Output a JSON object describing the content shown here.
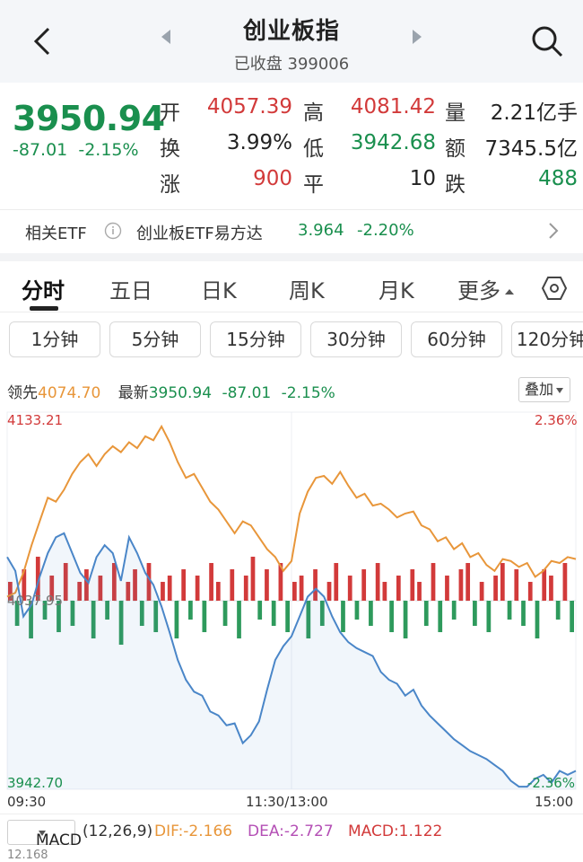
{
  "header": {
    "title": "创业板指",
    "subtitle": "已收盘 399006"
  },
  "quote": {
    "price": "3950.94",
    "change": "-87.01",
    "change_pct": "-2.15%",
    "open_label": "开",
    "open": "4057.39",
    "high_label": "高",
    "high": "4081.42",
    "volume_label": "量",
    "volume": "2.21亿手",
    "turnover_label": "换",
    "turnover": "3.99%",
    "low_label": "低",
    "low": "3942.68",
    "amount_label": "额",
    "amount": "7345.5亿",
    "up_label": "涨",
    "up": "900",
    "flat_label": "平",
    "flat": "10",
    "down_label": "跌",
    "down": "488"
  },
  "etf": {
    "label": "相关ETF",
    "name": "创业板ETF易方达",
    "price": "3.964",
    "change_pct": "-2.20%"
  },
  "tabs": [
    "分时",
    "五日",
    "日K",
    "周K",
    "月K",
    "更多"
  ],
  "periods": [
    "1分钟",
    "5分钟",
    "15分钟",
    "30分钟",
    "60分钟",
    "120分钟"
  ],
  "info_bar": {
    "leader_label": "领先",
    "leader": "4074.70",
    "latest_label": "最新",
    "latest": "3950.94",
    "change": "-87.01",
    "change_pct": "-2.15%",
    "overlay_label": "叠加"
  },
  "chart_data": {
    "type": "line",
    "y_max_label": "4133.21",
    "y_mid_label": "4037.95",
    "y_min_label": "3942.70",
    "pct_max_label": "2.36%",
    "pct_min_label": "-2.36%",
    "x_labels": [
      "09:30",
      "11:30/13:00",
      "15:00"
    ],
    "ylim": [
      3942.7,
      4133.21
    ],
    "prev_close": 4037.95,
    "series": [
      {
        "color": "#e8963a",
        "values": [
          4040,
          4042,
          4052,
          4066,
          4078,
          4090,
          4088,
          4094,
          4102,
          4108,
          4112,
          4106,
          4112,
          4116,
          4113,
          4118,
          4115,
          4121,
          4119,
          4126,
          4118,
          4108,
          4100,
          4102,
          4095,
          4088,
          4084,
          4078,
          4072,
          4078,
          4076,
          4070,
          4064,
          4060,
          4053,
          4058,
          4082,
          4093,
          4100,
          4101,
          4097,
          4103,
          4096,
          4090,
          4092,
          4086,
          4087,
          4084,
          4080,
          4082,
          4083,
          4076,
          4074,
          4068,
          4070,
          4064,
          4067,
          4060,
          4062,
          4056,
          4053,
          4059,
          4058,
          4055,
          4057,
          4050,
          4053,
          4058,
          4057,
          4060,
          4059
        ]
      },
      {
        "color": "#4a86c8",
        "values": [
          4060,
          4053,
          4030,
          4036,
          4050,
          4062,
          4070,
          4072,
          4062,
          4052,
          4047,
          4060,
          4066,
          4062,
          4048,
          4070,
          4062,
          4052,
          4046,
          4035,
          4022,
          4008,
          3998,
          3992,
          3990,
          3982,
          3980,
          3975,
          3976,
          3966,
          3970,
          3977,
          3993,
          4008,
          4015,
          4020,
          4030,
          4040,
          4044,
          4040,
          4030,
          4022,
          4017,
          4014,
          4012,
          4010,
          4002,
          3998,
          3996,
          3990,
          3993,
          3985,
          3980,
          3976,
          3972,
          3968,
          3965,
          3962,
          3960,
          3958,
          3955,
          3952,
          3947,
          3944,
          3944,
          3948,
          3950,
          3946,
          3952,
          3950,
          3952
        ]
      }
    ],
    "volume_bars": [
      3,
      -4,
      5,
      -6,
      7,
      -3,
      4,
      -5,
      6,
      -4,
      3,
      5,
      -6,
      4,
      -3,
      6,
      -7,
      3,
      5,
      -4,
      6,
      -5,
      3,
      4,
      -6,
      5,
      -3,
      4,
      -5,
      6,
      3,
      -4,
      5,
      -6,
      4,
      7,
      -3,
      5,
      -4,
      6,
      -5,
      3,
      4,
      -6,
      5,
      -4,
      3,
      6,
      -5,
      4,
      -3,
      5,
      -4,
      6,
      3,
      -5,
      4,
      -6,
      5,
      3,
      -4,
      6,
      -5,
      4,
      -3,
      5,
      6,
      -4,
      3,
      -5,
      4,
      6,
      -3,
      5,
      -4,
      3,
      -6,
      5,
      4,
      -3,
      6,
      -5
    ]
  },
  "macd": {
    "selector": "MACD",
    "params": "(12,26,9)",
    "dif": "DIF:-2.166",
    "dea": "DEA:-2.727",
    "macd": "MACD:1.122",
    "axis_value": "12.168"
  }
}
